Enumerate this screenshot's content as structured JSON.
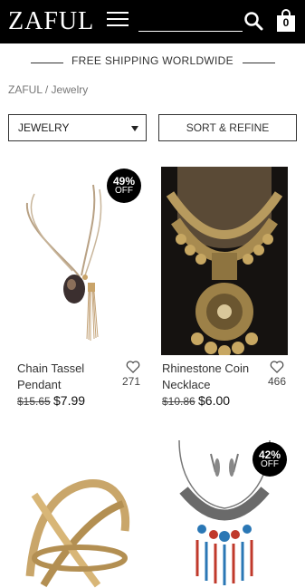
{
  "header": {
    "logo": "ZAFUL",
    "cart_count": "0",
    "icons": [
      "menu-icon",
      "search-icon",
      "shopping-bag-icon"
    ]
  },
  "banner": {
    "text": "FREE SHIPPING WORLDWIDE"
  },
  "breadcrumb": {
    "text": "ZAFUL / Jewelry"
  },
  "filters": {
    "category_value": "JEWELRY",
    "sort_label": "SORT & REFINE"
  },
  "products": [
    {
      "name_line1": "Chain Tassel",
      "name_line2": "Pendant",
      "old_price": "$15.65",
      "price": "$7.99",
      "likes": "271",
      "discount": "49%",
      "discount_off": "OFF"
    },
    {
      "name_line1": "Rhinestone Coin",
      "name_line2": "Necklace",
      "old_price": "$10.86",
      "price": "$6.00",
      "likes": "466"
    },
    {
      "name_line1": "",
      "name_line2": ""
    },
    {
      "discount": "42%",
      "discount_off": "OFF"
    }
  ]
}
